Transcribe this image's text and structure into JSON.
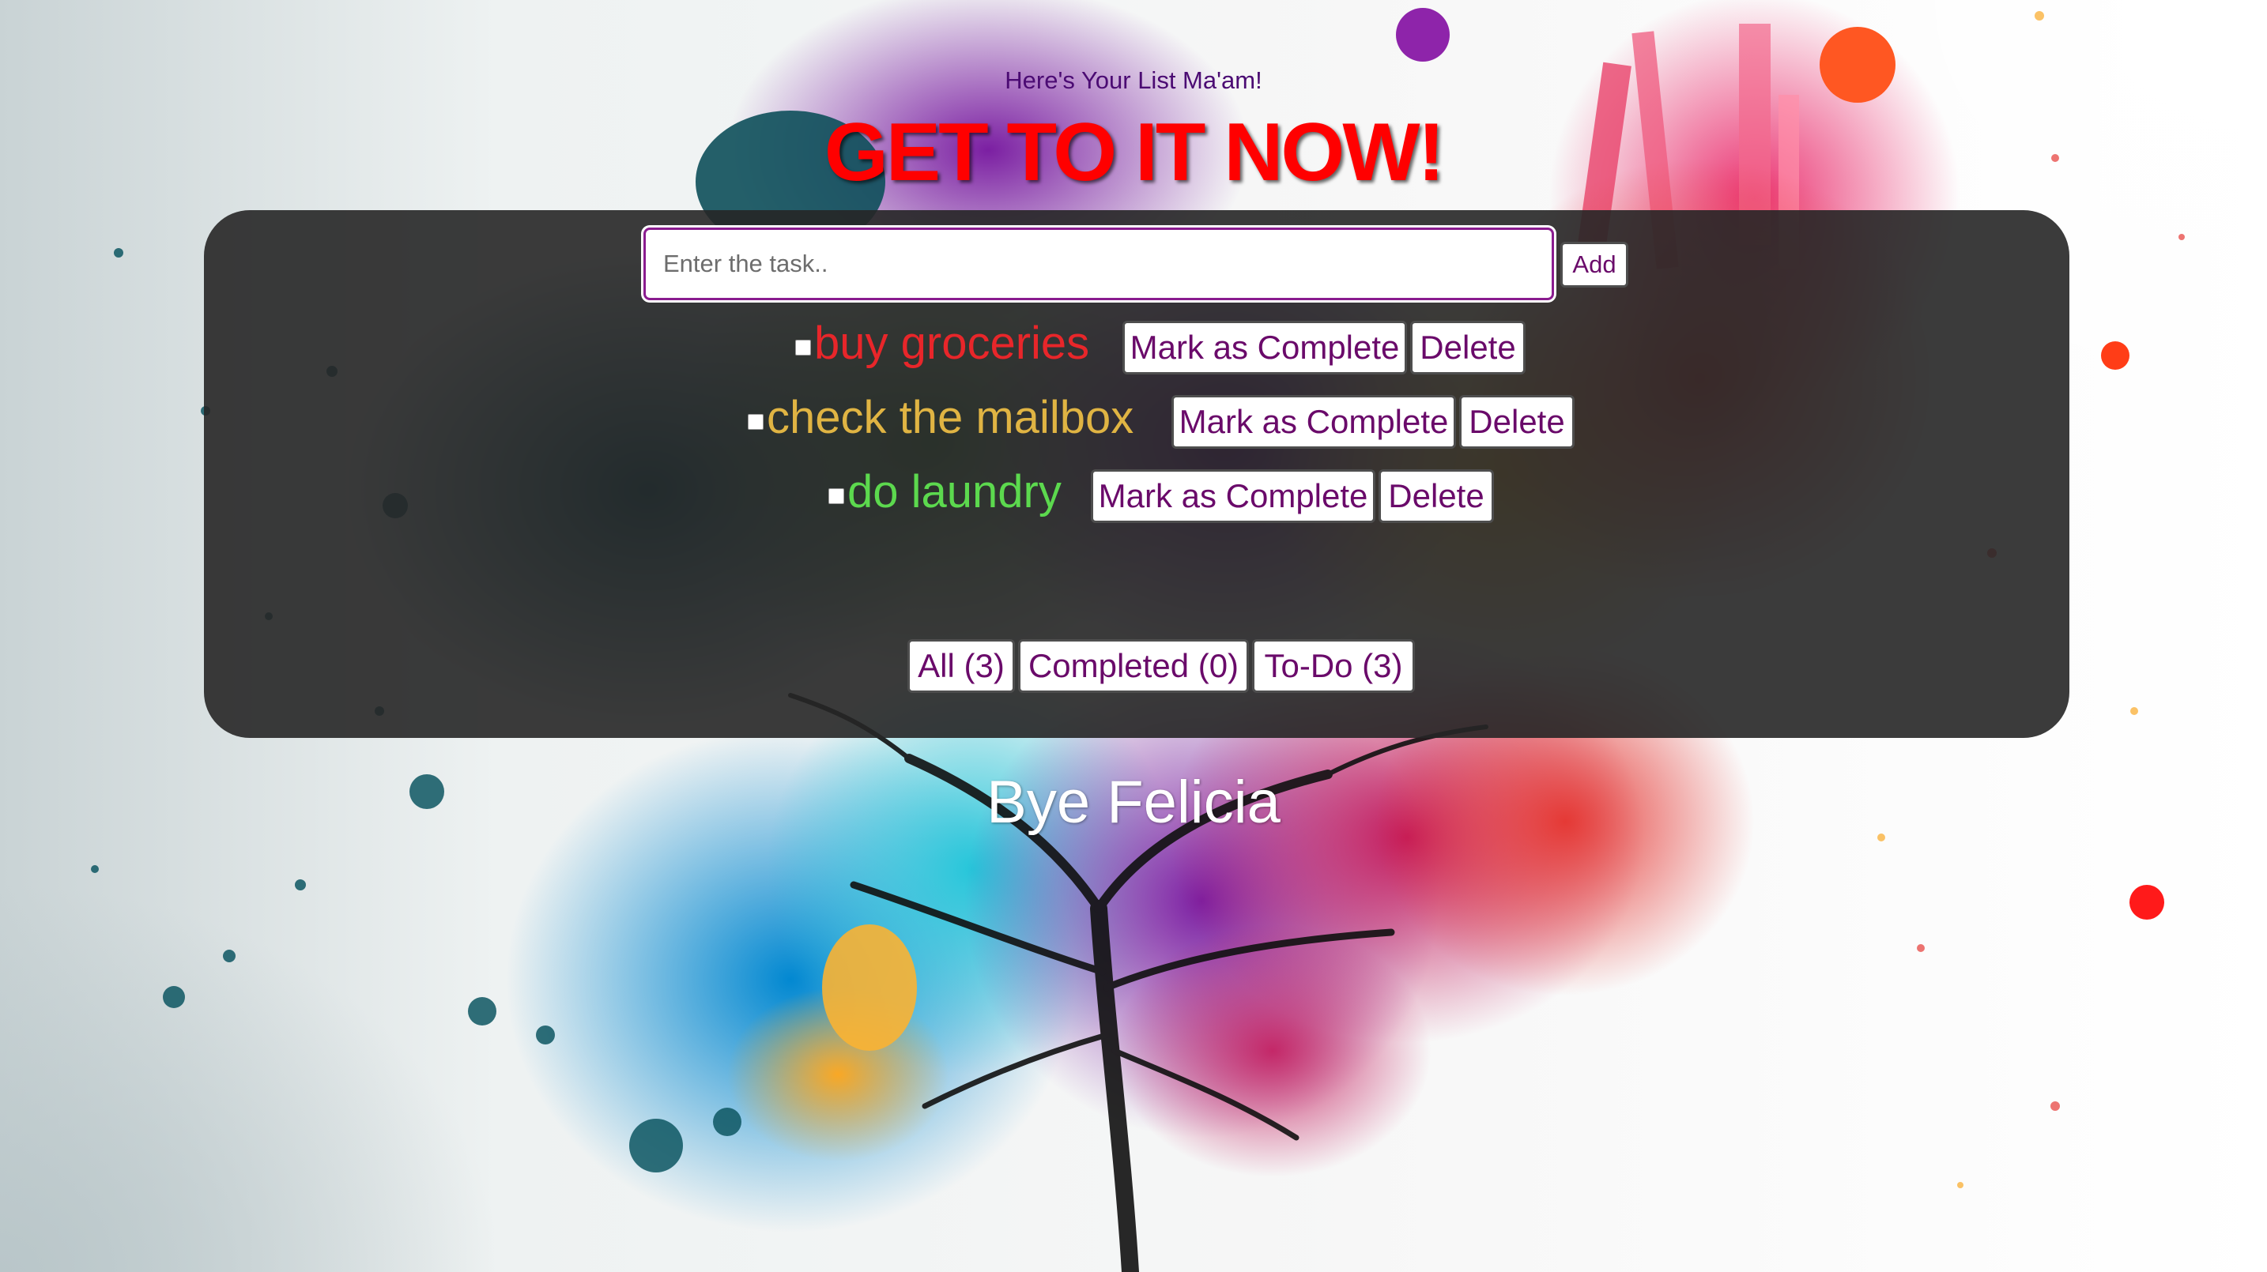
{
  "header": {
    "subtitle": "Here's Your List Ma'am!",
    "title": "GET TO IT NOW!"
  },
  "input": {
    "placeholder": "Enter the task..",
    "value": "",
    "add_label": "Add"
  },
  "tasks": [
    {
      "text": "buy groceries",
      "color": "#e8262a",
      "complete_label": "Mark as Complete",
      "delete_label": "Delete",
      "checked": false
    },
    {
      "text": "check the mailbox",
      "color": "#e0b443",
      "complete_label": "Mark as Complete",
      "delete_label": "Delete",
      "checked": false
    },
    {
      "text": "do laundry",
      "color": "#5cd94e",
      "complete_label": "Mark as Complete",
      "delete_label": "Delete",
      "checked": false
    }
  ],
  "filters": {
    "all": "All (3)",
    "completed": "Completed (0)",
    "todo": "To-Do (3)"
  },
  "footer": {
    "text": "Bye Felicia"
  },
  "colors": {
    "title": "#ff0000",
    "subtitle": "#4b0b73",
    "button_text": "#6a0a6a",
    "panel": "#262626",
    "input_border": "#8a1c8f"
  }
}
